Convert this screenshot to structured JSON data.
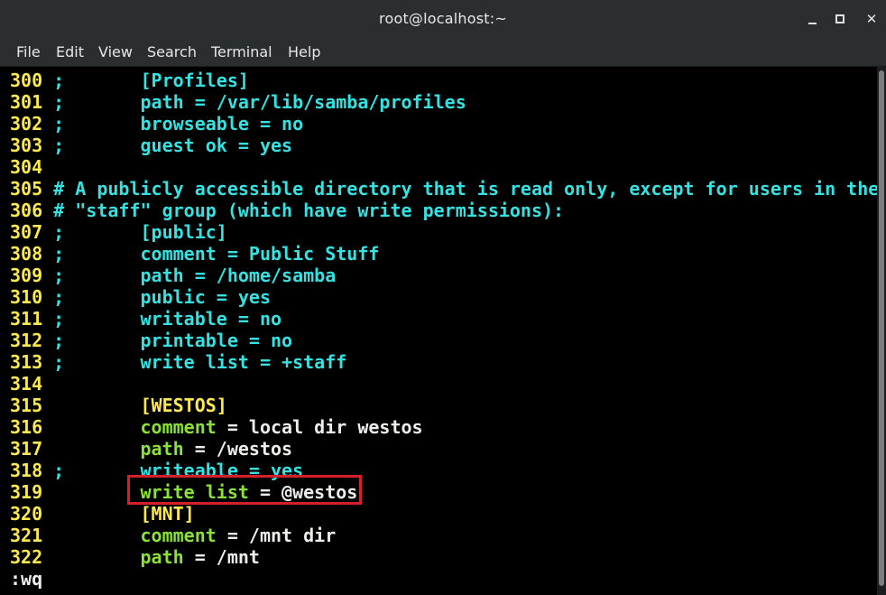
{
  "window": {
    "title": "root@localhost:~"
  },
  "menu": [
    "File",
    "Edit",
    "View",
    "Search",
    "Terminal",
    "Help"
  ],
  "lines": [
    {
      "num": "300",
      "prefix": ";",
      "text": "[Profiles]"
    },
    {
      "num": "301",
      "prefix": ";",
      "text": "path = /var/lib/samba/profiles"
    },
    {
      "num": "302",
      "prefix": ";",
      "text": "browseable = no"
    },
    {
      "num": "303",
      "prefix": ";",
      "text": "guest ok = yes"
    },
    {
      "num": "304",
      "prefix": "",
      "text": ""
    },
    {
      "num": "305",
      "prefix": "",
      "text": "# A publicly accessible directory that is read only, except for users in the"
    },
    {
      "num": "306",
      "prefix": "",
      "text": "# \"staff\" group (which have write permissions):"
    },
    {
      "num": "307",
      "prefix": ";",
      "text": "[public]"
    },
    {
      "num": "308",
      "prefix": ";",
      "text": "comment = Public Stuff"
    },
    {
      "num": "309",
      "prefix": ";",
      "text": "path = /home/samba"
    },
    {
      "num": "310",
      "prefix": ";",
      "text": "public = yes"
    },
    {
      "num": "311",
      "prefix": ";",
      "text": "writable = no"
    },
    {
      "num": "312",
      "prefix": ";",
      "text": "printable = no"
    },
    {
      "num": "313",
      "prefix": ";",
      "text": "write list = +staff"
    },
    {
      "num": "314",
      "prefix": "",
      "text": ""
    },
    {
      "num": "315",
      "prefix": "",
      "section": "[WESTOS]"
    },
    {
      "num": "316",
      "prefix": "",
      "key": "comment",
      "value": " = local dir westos"
    },
    {
      "num": "317",
      "prefix": "",
      "key": "path",
      "value": " = /westos"
    },
    {
      "num": "318",
      "prefix": ";",
      "text": "writeable = yes"
    },
    {
      "num": "319",
      "prefix": "",
      "key": "write list",
      "value": " = @westos"
    },
    {
      "num": "320",
      "prefix": "",
      "section": "[MNT]"
    },
    {
      "num": "321",
      "prefix": "",
      "key": "comment",
      "value": " = /mnt dir"
    },
    {
      "num": "322",
      "prefix": "",
      "key": "path",
      "value": " = /mnt"
    }
  ],
  "command_line": ":wq",
  "colors": {
    "line_number": "#fce94f",
    "comment": "#34e2e2",
    "key": "#8ae234",
    "section": "#fce94f",
    "value": "#eeeeec",
    "highlight": "#d4202a"
  }
}
